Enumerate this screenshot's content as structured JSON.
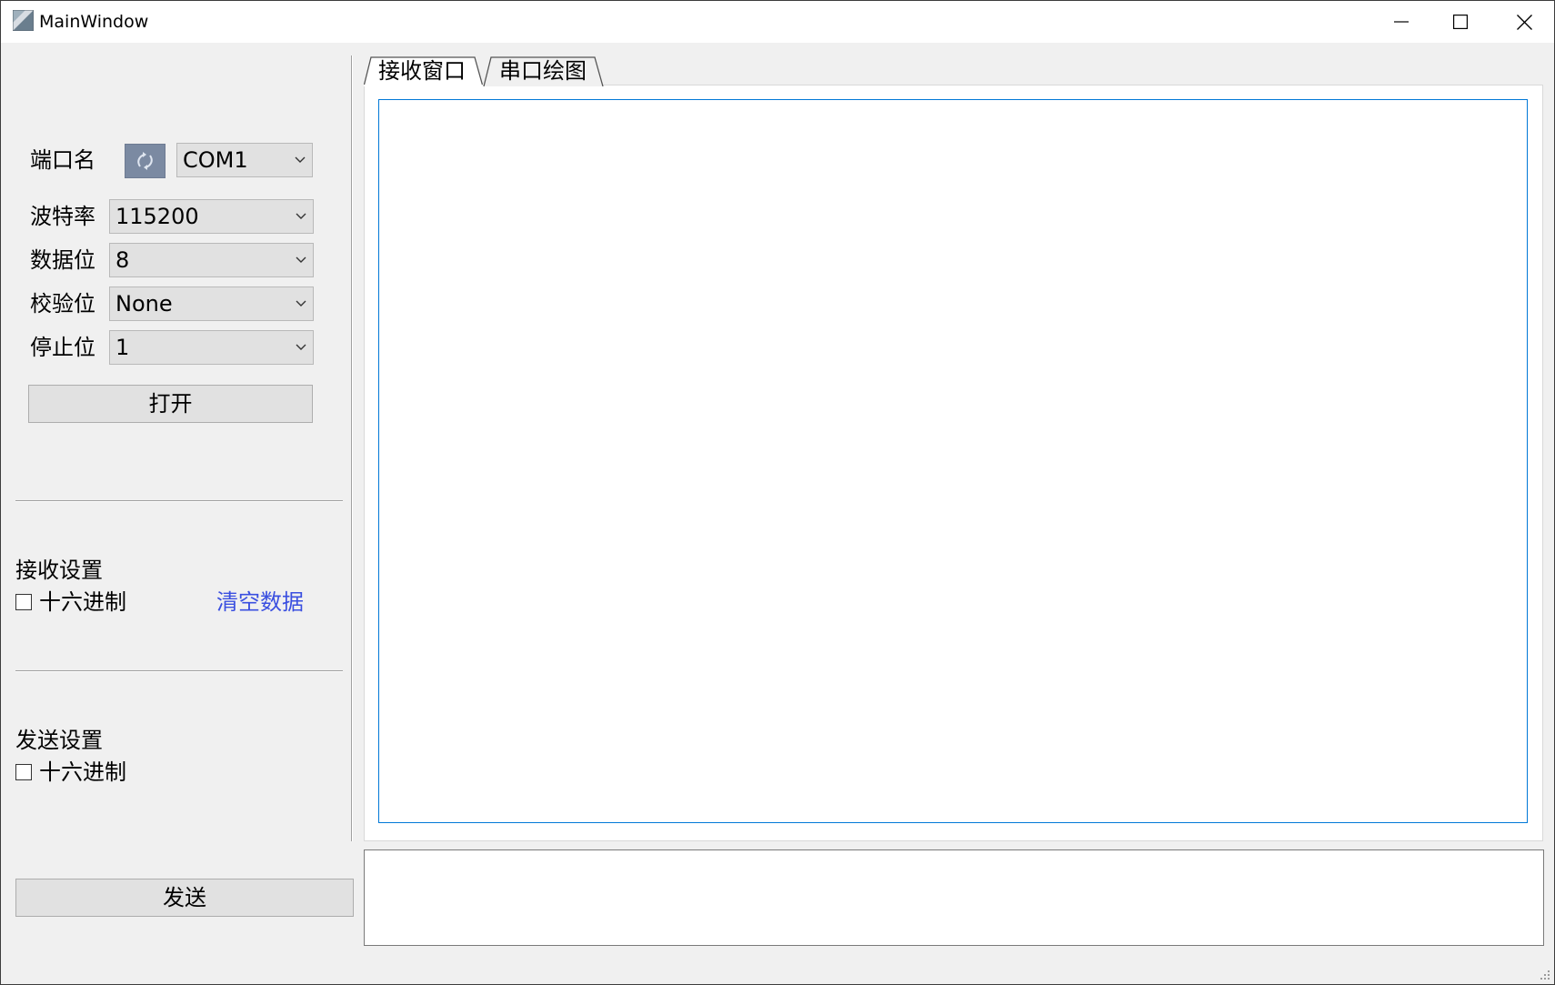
{
  "window": {
    "title": "MainWindow",
    "controls": [
      "minimize-icon",
      "maximize-icon",
      "close-icon"
    ]
  },
  "serial": {
    "port_label": "端口名",
    "port_value": "COM1",
    "baud_label": "波特率",
    "baud_value": "115200",
    "databits_label": "数据位",
    "databits_value": "8",
    "parity_label": "校验位",
    "parity_value": "None",
    "stopbits_label": "停止位",
    "stopbits_value": "1",
    "open_button": "打开",
    "refresh_icon": "refresh-icon"
  },
  "receive_settings": {
    "title": "接收设置",
    "hex_label": "十六进制",
    "hex_checked": false,
    "clear_link": "清空数据",
    "link_color": "#3a4fe0"
  },
  "send_settings": {
    "title": "发送设置",
    "hex_label": "十六进制",
    "hex_checked": false,
    "send_button": "发送"
  },
  "tabs": [
    {
      "label": "接收窗口",
      "active": true
    },
    {
      "label": "串口绘图",
      "active": false
    }
  ],
  "colors": {
    "focus_border": "#0078d7",
    "refresh_button": "#7b8aa2"
  }
}
